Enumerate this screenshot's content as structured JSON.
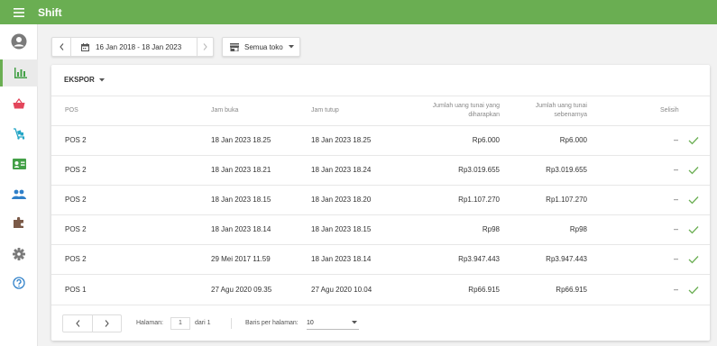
{
  "app": {
    "title": "Shift"
  },
  "filters": {
    "date_range": "16 Jan 2018 - 18 Jan 2023",
    "store": "Semua toko"
  },
  "table": {
    "export_label": "EKSPOR",
    "headers": {
      "pos": "POS",
      "open": "Jam buka",
      "close": "Jam tutup",
      "expected_1": "Jumlah uang tunai yang",
      "expected_2": "diharapkan",
      "actual_1": "Jumlah uang tunai",
      "actual_2": "sebenarnya",
      "diff": "Selisih"
    },
    "rows": [
      {
        "pos": "POS 2",
        "open": "18 Jan 2023 18.25",
        "close": "18 Jan 2023 18.25",
        "expected": "Rp6.000",
        "actual": "Rp6.000",
        "diff": "–"
      },
      {
        "pos": "POS 2",
        "open": "18 Jan 2023 18.21",
        "close": "18 Jan 2023 18.24",
        "expected": "Rp3.019.655",
        "actual": "Rp3.019.655",
        "diff": "–"
      },
      {
        "pos": "POS 2",
        "open": "18 Jan 2023 18.15",
        "close": "18 Jan 2023 18.20",
        "expected": "Rp1.107.270",
        "actual": "Rp1.107.270",
        "diff": "–"
      },
      {
        "pos": "POS 2",
        "open": "18 Jan 2023 18.14",
        "close": "18 Jan 2023 18.15",
        "expected": "Rp98",
        "actual": "Rp98",
        "diff": "–"
      },
      {
        "pos": "POS 2",
        "open": "29 Mei 2017 11.59",
        "close": "18 Jan 2023 18.14",
        "expected": "Rp3.947.443",
        "actual": "Rp3.947.443",
        "diff": "–"
      },
      {
        "pos": "POS 1",
        "open": "27 Agu 2020 09.35",
        "close": "27 Agu 2020 10.04",
        "expected": "Rp66.915",
        "actual": "Rp66.915",
        "diff": "–"
      }
    ]
  },
  "pagination": {
    "page_label": "Halaman:",
    "page_value": "1",
    "of_label": "dari 1",
    "rows_label": "Baris per halaman:",
    "rows_value": "10"
  },
  "colors": {
    "brand": "#6aae52",
    "icon_red": "#e3465b",
    "icon_teal": "#26a6c6",
    "icon_green": "#43a047",
    "icon_blue": "#2f80c9",
    "icon_brown": "#7b5a48",
    "icon_gray": "#7a7a7a"
  },
  "sidebar_icons": [
    "account-icon",
    "reports-icon",
    "store-basket-icon",
    "inventory-icon",
    "employee-card-icon",
    "customers-icon",
    "integrations-icon",
    "settings-icon",
    "help-icon"
  ]
}
